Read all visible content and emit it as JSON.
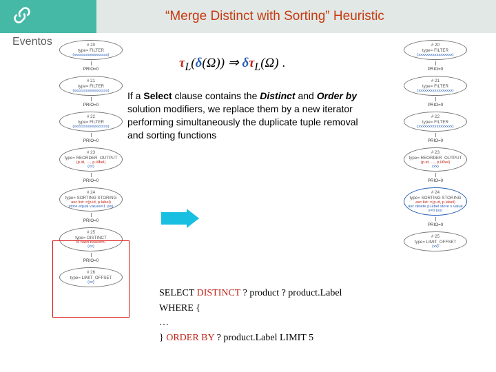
{
  "header": {
    "subhead": "Eventos",
    "title": "“Merge Distinct with Sorting” Heuristic"
  },
  "formula": {
    "tau1": "τ",
    "sub": "L",
    "lp1": "(",
    "delta1": "δ",
    "omega1": "(Ω)",
    "rp1": ")",
    "imp": " ⇒ ",
    "delta2": "δ",
    "tau2": "τ",
    "sub2": "L",
    "omega2": "(Ω)",
    "stop": " ."
  },
  "para": {
    "l1a": "If a ",
    "l1b": "Select",
    "l1c": " clause contains the ",
    "l1d": "Distinct",
    "l1e": " and ",
    "l2a": "Order by",
    "l2b": " solution modifiers, we replace them by a new iterator performing simultaneously the duplicate tuple removal and sorting functions"
  },
  "sparql": {
    "l1a": "SELECT ",
    "l1b": "DISTINCT",
    "l1c": " ? product ? product.Label",
    "l2": "WHERE {",
    "l3": "…",
    "l4a": "} ",
    "l4b": "ORDER BY",
    "l4c": " ? product.Label LIMIT 5"
  },
  "pipeL": {
    "n0": {
      "num": "# 20",
      "ty": "type= FILTER",
      "extra": "(xxxxxxxxxxxxxxxxx)"
    },
    "p0": "PRIO=0",
    "n1": {
      "num": "# 21",
      "ty": "type= FILTER",
      "extra": "(xxxxxxxxxxxxxxxxx)"
    },
    "p1": "PRIO=0",
    "n2": {
      "num": "# 22",
      "ty": "type= FILTER",
      "extra": "(xxxxxxxxxxxxxxxxx)"
    },
    "p2": "PRIO=0",
    "n3": {
      "num": "# 23",
      "ty": "type= REORDER_OUTPUT",
      "extra": "(p.id, …, p.label)",
      "extra2": "(xx)"
    },
    "p3": "PRIO=0",
    "n4": {
      "num": "# 24",
      "ty": "type= SORTING STORING",
      "extra": "asc list: =(p.id, p.label)",
      "extra2": "store equal values=1 (xx)"
    },
    "p4": "PRIO=0",
    "n5": {
      "num": "# 25",
      "ty": "type= DISTINCT",
      "extra": "is hash based=0",
      "extra2": "(xx)"
    },
    "p5": "PRIO=0",
    "n6": {
      "num": "# 26",
      "ty": "type= LIMIT_OFFSET",
      "extra": "(xx)"
    }
  },
  "pipeR": {
    "n0": {
      "num": "# 20",
      "ty": "type= FILTER",
      "extra": "(xxxxxxxxxxxxxxxxx)"
    },
    "p0": "PRIO=0",
    "n1": {
      "num": "# 21",
      "ty": "type= FILTER",
      "extra": "(xxxxxxxxxxxxxxxxx)"
    },
    "p1": "PRIO=0",
    "n2": {
      "num": "# 22",
      "ty": "type= FILTER",
      "extra": "(xxxxxxxxxxxxxxxxx)"
    },
    "p2": "PRIO=0",
    "n3": {
      "num": "# 23",
      "ty": "type= REORDER_OUTPUT",
      "extra": "(p.id, …, p.label)",
      "extra2": "(xx)"
    },
    "p3": "PRIO=0",
    "n4": {
      "num": "# 24",
      "ty": "type= SORTING STORING",
      "extra": "asc list: =(p.id, p.label)",
      "extra2": "asc delete p.label  store s.values=0 (xx)"
    },
    "p4": "PRIO=0",
    "n5": {
      "num": "# 25",
      "ty": "type= LIMIT_OFFSET",
      "extra": "(xx)"
    }
  }
}
